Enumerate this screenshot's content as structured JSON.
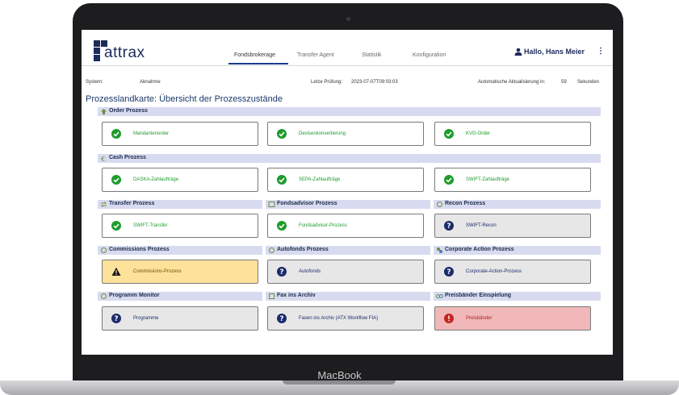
{
  "device": {
    "label": "MacBook"
  },
  "app": {
    "logo_text": "attrax",
    "brand_color": "#1b2b5a",
    "tabs": [
      {
        "label": "Fondsbrokerage",
        "active": true
      },
      {
        "label": "Transfer Agent",
        "active": false
      },
      {
        "label": "Statistik",
        "active": false
      },
      {
        "label": "Konfiguration",
        "active": false
      }
    ],
    "user": {
      "greeting": "Hallo, Hans Meier",
      "icon": "user-icon",
      "menu_glyph": "⋮"
    }
  },
  "meta": {
    "system_label": "System:",
    "system_value": "Abnahme",
    "check_label": "Letze Prüfung:",
    "check_value": "2023-07-07T09:03:03",
    "refresh_label": "Automatische Aktualisierung in:",
    "refresh_value": "59",
    "refresh_unit": "Sekunden"
  },
  "page_title": "Prozesslandkarte: Übersicht der Prozesszustände",
  "status_colors": {
    "ok": "#1e9b2d",
    "unknown": "#1b2b6a",
    "warning": "#f3c21a",
    "error": "#c0261f"
  },
  "sections": {
    "order": {
      "title": "Order Prozess",
      "cards": [
        {
          "label": "Mandantenorder",
          "status": "ok"
        },
        {
          "label": "Devisenkonvertierung",
          "status": "ok"
        },
        {
          "label": "KVG-Order",
          "status": "ok"
        }
      ]
    },
    "cash": {
      "title": "Cash Prozess",
      "cards": [
        {
          "label": "DASKA-Zahlaufträge",
          "status": "ok"
        },
        {
          "label": "SEPA-Zahlaufträge",
          "status": "ok"
        },
        {
          "label": "SWIFT-Zahlaufträge",
          "status": "ok"
        }
      ]
    },
    "transfer": {
      "title": "Transfer Prozess",
      "card": {
        "label": "SWIFT-Transfer",
        "status": "ok"
      }
    },
    "fondsadvisor": {
      "title": "Fondsadvisor Prozess",
      "card": {
        "label": "Fondsadvisor-Prozess",
        "status": "ok"
      }
    },
    "recon": {
      "title": "Recon Prozess",
      "card": {
        "label": "SWIFT-Recon",
        "status": "unknown"
      }
    },
    "commissions": {
      "title": "Commissions Prozess",
      "card": {
        "label": "Commissions-Prozess",
        "status": "warning"
      }
    },
    "autofonds": {
      "title": "Autofonds Prozess",
      "card": {
        "label": "Autofonds",
        "status": "unknown"
      }
    },
    "corporate": {
      "title": "Corporate Action Prozess",
      "card": {
        "label": "Corporate-Action-Prozess",
        "status": "unknown"
      }
    },
    "monitor": {
      "title": "Programm Monitor",
      "card": {
        "label": "Programme",
        "status": "unknown"
      }
    },
    "fax": {
      "title": "Fax ins Archiv",
      "card": {
        "label": "Faxen ins Archiv (ATX Workflow FIA)",
        "status": "unknown"
      }
    },
    "preis": {
      "title": "Preisbänder Einspielung",
      "card": {
        "label": "Preisbänder",
        "status": "error"
      }
    }
  }
}
